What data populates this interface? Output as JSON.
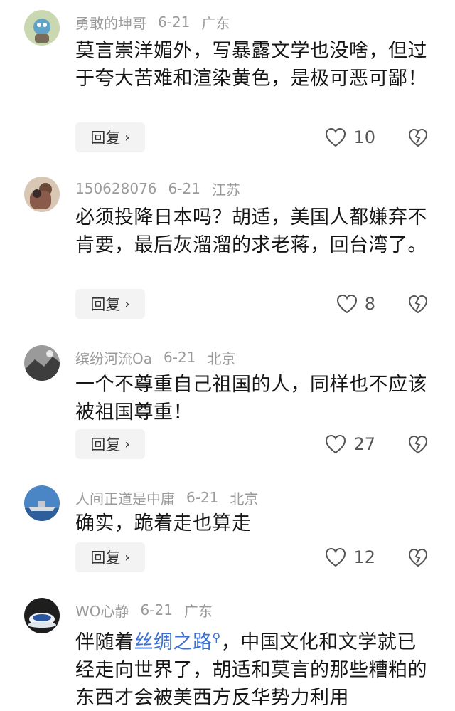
{
  "comments": [
    {
      "user": "勇敢的坤哥",
      "date": "6-21",
      "location": "广东",
      "text": "莫言崇洋媚外，写暴露文学也没啥，但过于夸大苦难和渲染黄色，是极可恶可鄙！",
      "reply_label": "回复",
      "likes": "10"
    },
    {
      "user": "150628076",
      "date": "6-21",
      "location": "江苏",
      "text": "必须投降日本吗？胡适，美国人都嫌弃不肯要，最后灰溜溜的求老蒋，回台湾了。",
      "reply_label": "回复",
      "likes": "8"
    },
    {
      "user": "缤纷河流Oa",
      "date": "6-21",
      "location": "北京",
      "text": "一个不尊重自己祖国的人，同样也不应该被祖国尊重！",
      "reply_label": "回复",
      "likes": "27"
    },
    {
      "user": "人间正道是中庸",
      "date": "6-21",
      "location": "北京",
      "text": "确实，跪着走也算走",
      "reply_label": "回复",
      "likes": "12"
    },
    {
      "user": "WO心静",
      "date": "6-21",
      "location": "广东",
      "text_before": "伴随着",
      "link_text": "丝绸之路",
      "text_after": "，中国文化和文学就已经走向世界了，胡适和莫言的那些糟粕的东西才会被美西方反华势力利用"
    }
  ],
  "icons": {
    "like": "heart-outline-icon",
    "dislike": "broken-heart-icon",
    "reply_chevron": "chevron-right-icon",
    "link_search": "magnifier-icon"
  },
  "colors": {
    "meta_gray": "#9a9a9a",
    "reply_bg": "#f3f3f3",
    "link_blue": "#3b6fd4"
  }
}
